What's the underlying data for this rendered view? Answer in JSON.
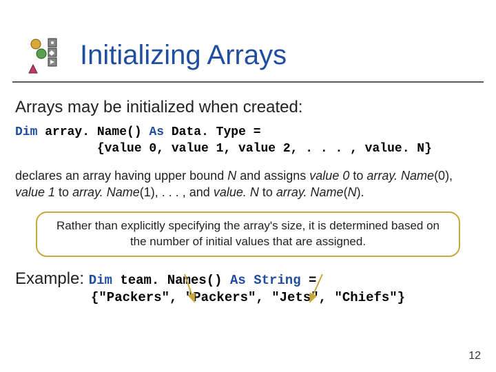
{
  "title": "Initializing Arrays",
  "intro": "Arrays may be initialized when created:",
  "syntax": {
    "line1_dim": "Dim ",
    "line1_name": "array. Name() ",
    "line1_as": "As ",
    "line1_type": "Data. Type ",
    "line1_eq": "=",
    "line2": "           {value 0, value 1, value 2, . . . , value. N}"
  },
  "description": {
    "text_prefix": " declares an array having upper bound ",
    "n": "N",
    "text_mid1": " and assigns ",
    "v0": "value 0",
    "text_mid2": " to ",
    "an0": "array. Name",
    "idx0": "(0), ",
    "v1": "value 1",
    "text_mid3": " to ",
    "an1": "array. Name",
    "idx1": "(1), . . . , and ",
    "vN": "value. N",
    "text_mid4": " to ",
    "anN": "array. Name",
    "idxN": "(",
    "nN": "N",
    "idxNend": ")."
  },
  "callout": "Rather than explicitly specifying the array's size, it is determined based on the number of initial values that are assigned.",
  "example": {
    "label": "Example: ",
    "line1_dim": "Dim ",
    "line1_name": "team. Names() ",
    "line1_as": "As ",
    "line1_type": "String ",
    "line1_eq": "=",
    "line2": "{\"Packers\", \"Packers\", \"Jets\", \"Chiefs\"}"
  },
  "pagenum": "12"
}
